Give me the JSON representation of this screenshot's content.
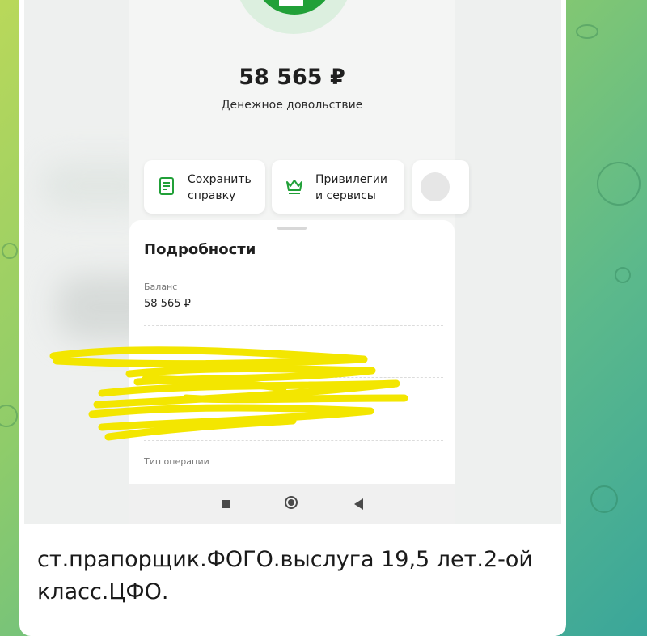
{
  "screenshot": {
    "amount": "58 565 ₽",
    "amount_caption": "Денежное довольствие",
    "actions": [
      {
        "label_line1": "Сохранить",
        "label_line2": "справку",
        "icon": "document-icon"
      },
      {
        "label_line1": "Привилегии",
        "label_line2": "и сервисы",
        "icon": "crown-icon"
      }
    ],
    "details": {
      "title": "Подробности",
      "fields": [
        {
          "label": "Баланс",
          "value": "58 565 ₽"
        },
        {
          "label": "Тип операции",
          "value": ""
        }
      ]
    },
    "colors": {
      "brand_green": "#21a038",
      "scribble_yellow": "#f3e600"
    }
  },
  "message": {
    "caption": "ст.прапорщик.ФОГО.выслуга 19,5 лет.2-ой класс.ЦФО."
  }
}
